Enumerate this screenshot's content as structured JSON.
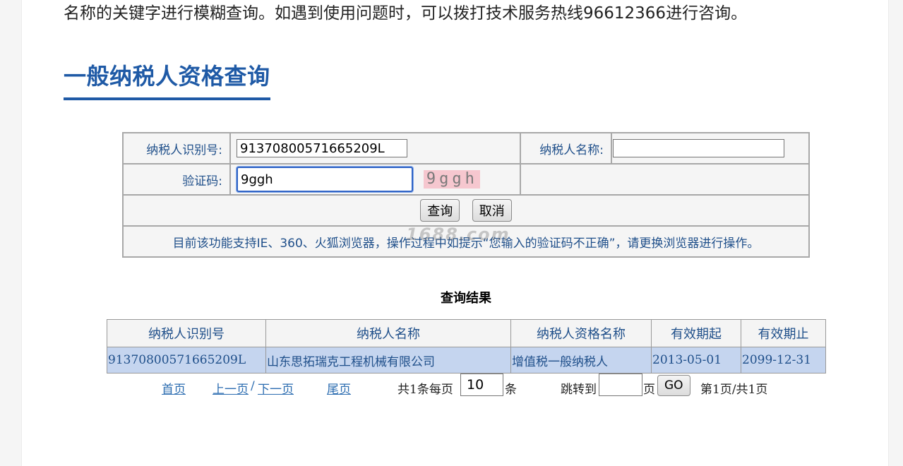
{
  "intro_text": "名称的关键字进行模糊查询。如遇到使用问题时，可以拨打技术服务热线96612366进行咨询。",
  "section_title": "一般纳税人资格查询",
  "form": {
    "taxpayer_id_label": "纳税人识别号:",
    "taxpayer_id_value": "91370800571665209L",
    "taxpayer_name_label": "纳税人名称:",
    "taxpayer_name_value": "",
    "captcha_label": "验证码:",
    "captcha_value": "9ggh",
    "captcha_image_text": "9ggh",
    "query_button": "查询",
    "cancel_button": "取消",
    "notice": "目前该功能支持IE、360、火狐浏览器，操作过程中如提示“您输入的验证码不正确”，请更换浏览器进行操作。"
  },
  "watermark": "1688.com",
  "results": {
    "title": "查询结果",
    "columns": [
      "纳税人识别号",
      "纳税人名称",
      "纳税人资格名称",
      "有效期起",
      "有效期止"
    ],
    "rows": [
      [
        "91370800571665209L",
        "山东思拓瑞克工程机械有限公司",
        "增值税一般纳税人",
        "2013-05-01",
        "2099-12-31"
      ]
    ]
  },
  "pager": {
    "first": "首页",
    "prev": "上一页",
    "slash": "/",
    "next": "下一页",
    "last": "尾页",
    "total_prefix": "共1条每页",
    "page_size": "10",
    "page_size_suffix": "条",
    "jump_label": "跳转到",
    "jump_value": "",
    "jump_suffix": "页",
    "go_button": "GO",
    "page_status": "第1页/共1页"
  }
}
